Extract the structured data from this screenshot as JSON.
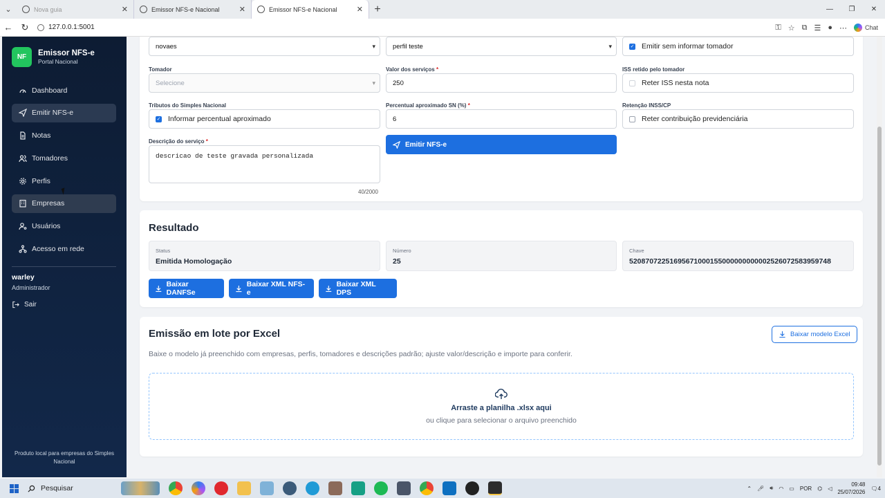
{
  "browser": {
    "tabs": [
      {
        "title": "Nova guia",
        "active": false
      },
      {
        "title": "Emissor NFS-e Nacional",
        "active": false
      },
      {
        "title": "Emissor NFS-e Nacional",
        "active": true
      }
    ],
    "url": "127.0.0.1:5001",
    "chat_label": "Chat"
  },
  "sidebar": {
    "logo_text": "NF",
    "brand_title": "Emissor NFS-e",
    "brand_subtitle": "Portal Nacional",
    "items": [
      {
        "label": "Dashboard",
        "icon": "gauge-icon"
      },
      {
        "label": "Emitir NFS-e",
        "icon": "send-icon"
      },
      {
        "label": "Notas",
        "icon": "document-icon"
      },
      {
        "label": "Tomadores",
        "icon": "users-icon"
      },
      {
        "label": "Perfis",
        "icon": "gear-icon"
      },
      {
        "label": "Empresas",
        "icon": "building-icon"
      },
      {
        "label": "Usuários",
        "icon": "user-cog-icon"
      },
      {
        "label": "Acesso em rede",
        "icon": "network-icon"
      }
    ],
    "user_name": "warley",
    "user_role": "Administrador",
    "logout_label": "Sair",
    "footer": "Produto local para empresas do Simples Nacional"
  },
  "form": {
    "empresa_value": "novaes",
    "perfil_value": "perfil teste",
    "emitir_sem_tomador_label": "Emitir sem informar tomador",
    "tomador_label": "Tomador",
    "tomador_placeholder": "Selecione",
    "valor_label": "Valor dos serviços",
    "valor_value": "250",
    "iss_label": "ISS retido pelo tomador",
    "iss_checkbox_label": "Reter ISS nesta nota",
    "tributos_label": "Tributos do Simples Nacional",
    "tributos_checkbox_label": "Informar percentual aproximado",
    "percentual_label": "Percentual aproximado SN (%)",
    "percentual_value": "6",
    "retencao_label": "Retenção INSS/CP",
    "retencao_checkbox_label": "Reter contribuição previdenciária",
    "descricao_label": "Descrição do serviço",
    "descricao_value": "descricao de teste gravada personalizada",
    "descricao_counter": "40/2000",
    "emitir_button": "Emitir NFS-e",
    "required_mark": "*"
  },
  "resultado": {
    "title": "Resultado",
    "status_label": "Status",
    "status_value": "Emitida Homologação",
    "numero_label": "Número",
    "numero_value": "25",
    "chave_label": "Chave",
    "chave_value": "52087072251695671000155000000000002526072583959748",
    "btn_danfse": "Baixar DANFSe",
    "btn_xml_nfse": "Baixar XML NFS-e",
    "btn_xml_dps": "Baixar XML DPS"
  },
  "lote": {
    "title": "Emissão em lote por Excel",
    "download_button": "Baixar modelo Excel",
    "description": "Baixe o modelo já preenchido com empresas, perfis, tomadores e descrições padrão; ajuste valor/descrição e importe para conferir.",
    "drop_title": "Arraste a planilha .xlsx aqui",
    "drop_subtitle": "ou clique para selecionar o arquivo preenchido"
  },
  "taskbar": {
    "search_label": "Pesquisar",
    "language": "POR",
    "time": "09:48",
    "date": "25/07/2026",
    "notifications": "4"
  },
  "colors": {
    "accent": "#1d6fe0",
    "sidebar": "#0d1c33",
    "logo": "#22c55e"
  }
}
